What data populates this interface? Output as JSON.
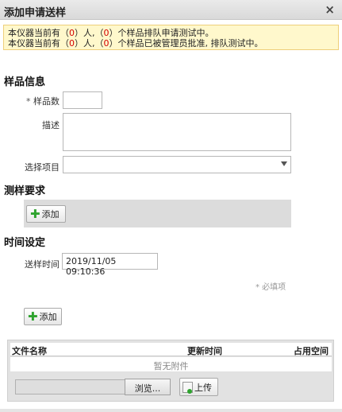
{
  "dialog": {
    "title": "添加申请送样",
    "close_icon": "×"
  },
  "notice": {
    "line1": {
      "prefix": "本仪器当前有（",
      "count1": "0",
      "mid": "）人,（",
      "count2": "0",
      "suffix": "）个样品排队申请测试中。"
    },
    "line2": {
      "prefix": "本仪器当前有（",
      "count1": "0",
      "mid": "）人,（",
      "count2": "0",
      "suffix": "）个样品已被管理员批准, 排队测试中。"
    }
  },
  "sample_info": {
    "heading": "样品信息",
    "count_label_req": "*",
    "count_label": "样品数",
    "count_value": "",
    "desc_label": "描述",
    "desc_value": "",
    "project_label": "选择项目",
    "project_value": ""
  },
  "test_req": {
    "heading": "测样要求",
    "add_label": "添加"
  },
  "time": {
    "heading": "时间设定",
    "send_label": "送样时间",
    "send_value": "2019/11/05 09:10:36",
    "required_hint": "* 必填项"
  },
  "attach": {
    "add_label": "添加",
    "columns": [
      "文件名称",
      "更新时间",
      "占用空间"
    ],
    "empty_text": "暂无附件",
    "browse_label": "浏览...",
    "upload_label": "上传"
  }
}
